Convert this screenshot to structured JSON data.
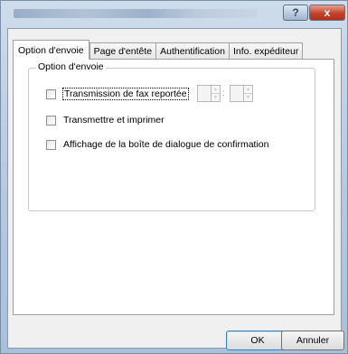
{
  "window": {
    "help_label": "?",
    "close_label": "x"
  },
  "tabs": [
    {
      "label": "Option d'envoie",
      "active": true
    },
    {
      "label": "Page d'entête",
      "active": false
    },
    {
      "label": "Authentification",
      "active": false
    },
    {
      "label": "Info. expéditeur",
      "active": false
    }
  ],
  "group": {
    "title": "Option d'envoie",
    "options": [
      {
        "label": "Transmission de fax reportée",
        "checked": false
      },
      {
        "label": "Transmettre et imprimer",
        "checked": false
      },
      {
        "label": "Affichage de la boîte de dialogue de confirmation",
        "checked": false
      }
    ],
    "time_separator": ":"
  },
  "buttons": {
    "ok": "OK",
    "cancel": "Annuler"
  }
}
